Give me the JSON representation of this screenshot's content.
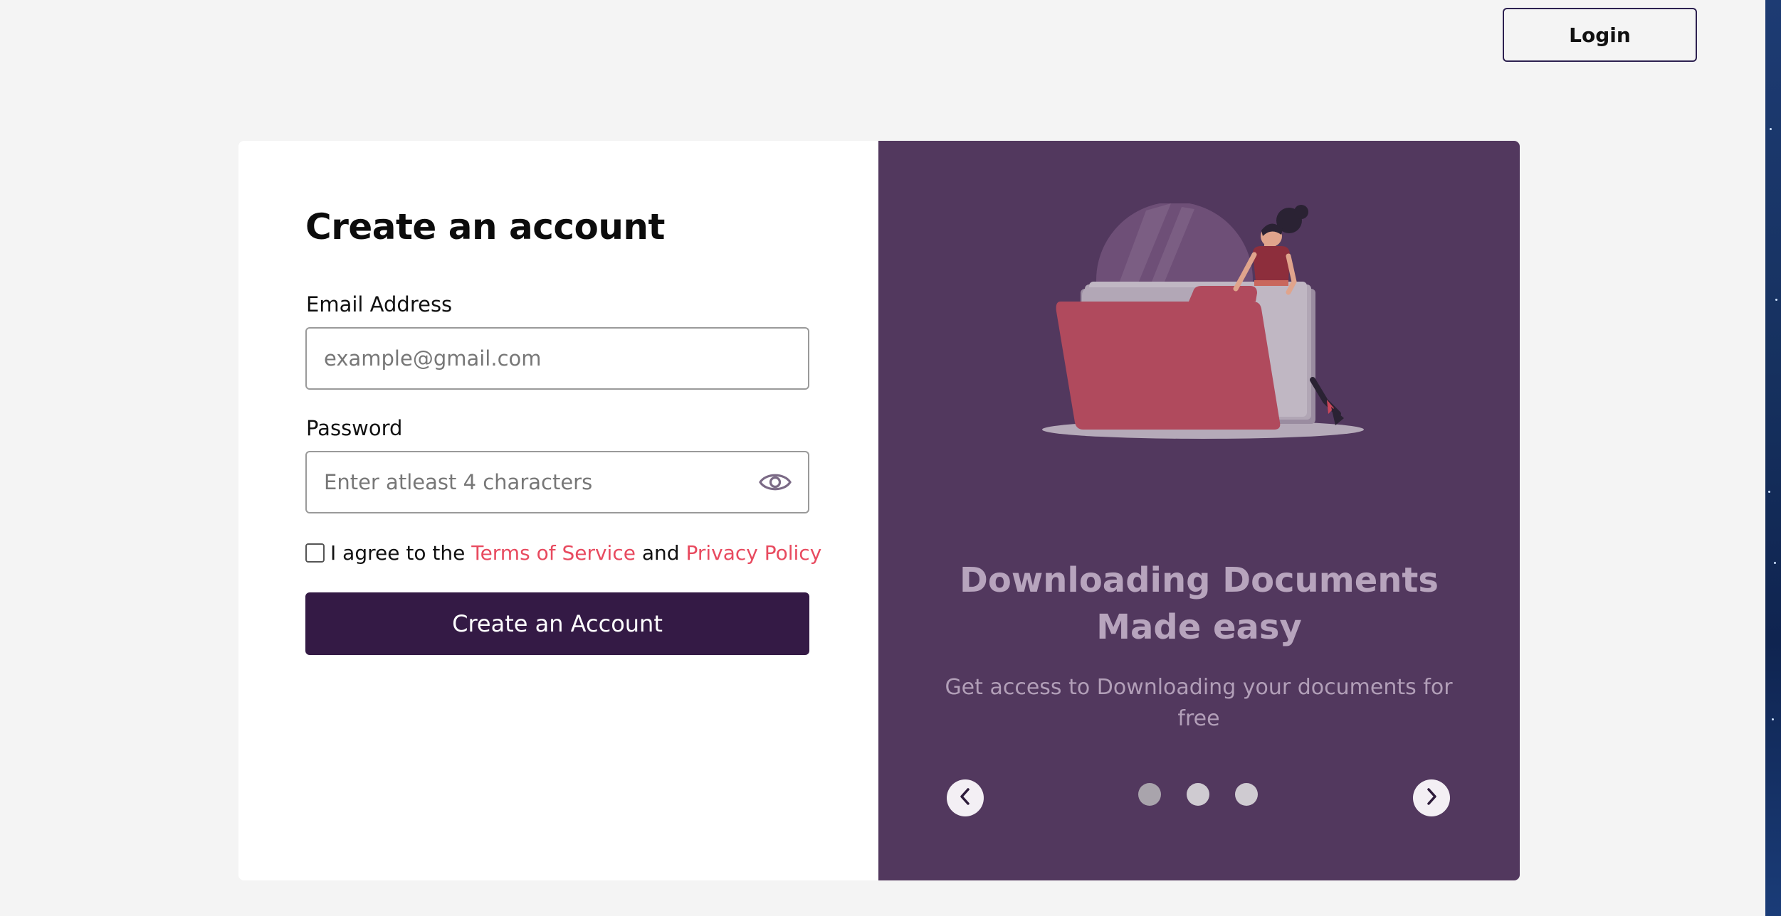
{
  "header": {
    "login_label": "Login"
  },
  "form": {
    "title": "Create an account",
    "email": {
      "label": "Email Address",
      "value": "",
      "placeholder": "example@gmail.com"
    },
    "password": {
      "label": "Password",
      "value": "",
      "placeholder": "Enter atleast 4 characters",
      "toggle_icon": "eye-icon"
    },
    "agree": {
      "checked": false,
      "prefix": "I agree to the",
      "terms_link": "Terms of Service",
      "conjunction": "and",
      "privacy_link": "Privacy Policy"
    },
    "submit_label": "Create an Account"
  },
  "promo": {
    "title_line1": "Downloading Documents",
    "title_line2": "Made easy",
    "subtitle": "Get access to Downloading your documents for free",
    "illustration": "woman-with-folder-illustration",
    "prev_icon": "chevron-left-icon",
    "next_icon": "chevron-right-icon",
    "slide_count": 3,
    "active_slide": 1
  },
  "colors": {
    "primary_dark": "#341a45",
    "promo_bg": "#52385e",
    "link": "#e84a5f",
    "page_bg": "#f4f4f4"
  }
}
